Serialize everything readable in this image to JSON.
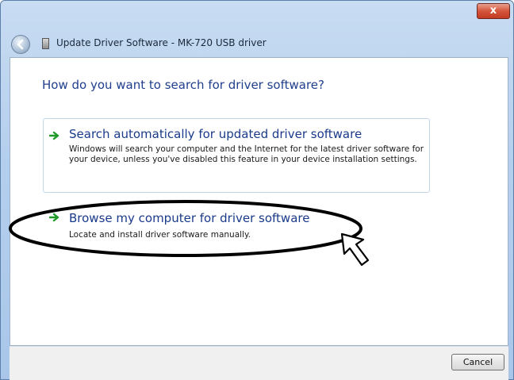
{
  "window": {
    "title": "Update Driver Software - MK-720 USB driver",
    "close_label": "x"
  },
  "main": {
    "heading": "How do you want to search for driver software?"
  },
  "options": [
    {
      "title": "Search automatically for updated driver software",
      "description": "Windows will search your computer and the Internet for the latest driver software for your device, unless you've disabled this feature in your device installation settings."
    },
    {
      "title": "Browse my computer for driver software",
      "description": "Locate and install driver software manually."
    }
  ],
  "footer": {
    "cancel_label": "Cancel"
  },
  "colors": {
    "accent_arrow": "#1f9a2a",
    "link_title": "#1a3a8a",
    "heading": "#1f3f8c"
  }
}
